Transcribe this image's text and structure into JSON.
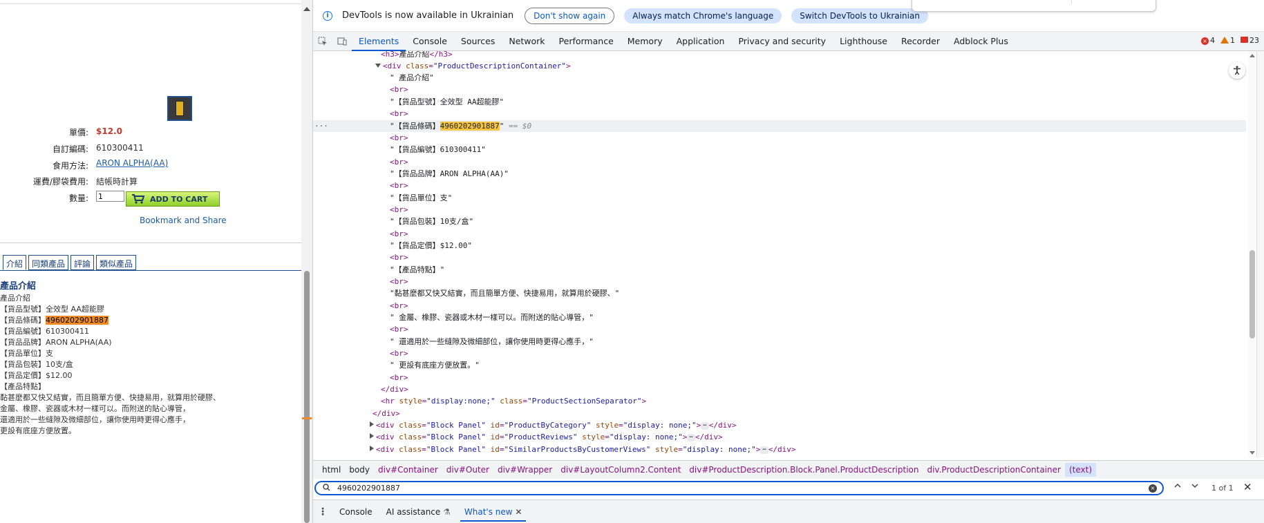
{
  "page": {
    "price_label": "單價:",
    "price_value": "$12.0",
    "code_label": "自訂編碼:",
    "code_value": "610300411",
    "usage_label": "食用方法:",
    "usage_value": "ARON ALPHA(AA)",
    "shipping_label": "運費/膠袋費用:",
    "shipping_value": "結帳時計算",
    "qty_label": "數量:",
    "qty_value": "1",
    "add_to_cart": "ADD TO CART",
    "bookmark": "Bookmark and Share",
    "tabs": [
      "介紹",
      "同類產品",
      "評論",
      "類似產品"
    ],
    "desc_title": "產品介紹",
    "desc_lines": [
      "產品介紹",
      "【貨品型號】全效型 AA超能膠",
      "【貨品條碼】",
      "【貨品編號】610300411",
      "【貨品品牌】ARON ALPHA(AA)",
      "【貨品單位】支",
      "【貨品包裝】10支/盒",
      "【貨品定價】$12.00",
      "【產品特點】",
      "黏甚麼都又快又結實，而且簡單方便、快捷易用，就算用於硬膠、",
      "金屬、橡膠、瓷器或木材一樣可以。而附送的貼心導管，",
      "還適用於一些縫隙及微細部位，讓你使用時更得心應手，",
      "更設有底座方便放置。"
    ],
    "barcode_highlight": "4960202901887"
  },
  "devtools": {
    "info_message": "DevTools is now available in Ukrainian",
    "btn_dont_show": "Don't show again",
    "btn_match_lang": "Always match Chrome's language",
    "btn_switch": "Switch DevTools to Ukrainian",
    "panels": [
      "Elements",
      "Console",
      "Sources",
      "Network",
      "Performance",
      "Memory",
      "Application",
      "Privacy and security",
      "Lighthouse",
      "Recorder",
      "Adblock Plus"
    ],
    "errors": "4",
    "warnings": "1",
    "messages": "23",
    "dom": {
      "l0": "產品介紹",
      "l1_class": "ProductDescriptionContainer",
      "t_intro": "\" 產品介紹\"",
      "t_model": "\"【貨品型號】全效型 AA超能膠\"",
      "t_barcode_pre": "\"【貨品條碼】",
      "t_barcode_hl": "4960202901887",
      "t_barcode_post": "\"",
      "t_dollar0": "== $0",
      "t_code": "\"【貨品編號】610300411\"",
      "t_brand": "\"【貨品品牌】ARON ALPHA(AA)\"",
      "t_unit": "\"【貨品單位】支\"",
      "t_pack": "\"【貨品包裝】10支/盒\"",
      "t_price": "\"【貨品定價】$12.00\"",
      "t_feature": "\"【產品特點】\"",
      "t_f1": "\"黏甚麼都又快又結實，而且簡單方便、快捷易用，就算用於硬膠、\"",
      "t_f2": "\" 金屬、橡膠、瓷器或木材一樣可以。而附送的貼心導管，\"",
      "t_f3": "\" 還適用於一些縫隙及微細部位，讓你使用時更得心應手，\"",
      "t_f4": "\" 更設有底座方便放置。\"",
      "hr_style": "display:none;",
      "hr_class": "ProductSectionSeparator",
      "block_class": "Block Panel",
      "id_cat": "ProductByCategory",
      "id_rev": "ProductReviews",
      "id_sim": "SimilarProductsByCustomerViews",
      "style_none": "display: none;",
      "ellipsis": "⋯",
      "tail": "</div>"
    },
    "breadcrumbs": [
      "html",
      "body",
      "div#Container",
      "div#Outer",
      "div#Wrapper",
      "div#LayoutColumn2.Content",
      "div#ProductDescription.Block.Panel.ProductDescription",
      "div.ProductDescriptionContainer",
      "(text)"
    ],
    "search_value": "4960202901887",
    "match_count": "1 of 1",
    "drawer_tabs": [
      "Console",
      "AI assistance",
      "What's new"
    ]
  }
}
